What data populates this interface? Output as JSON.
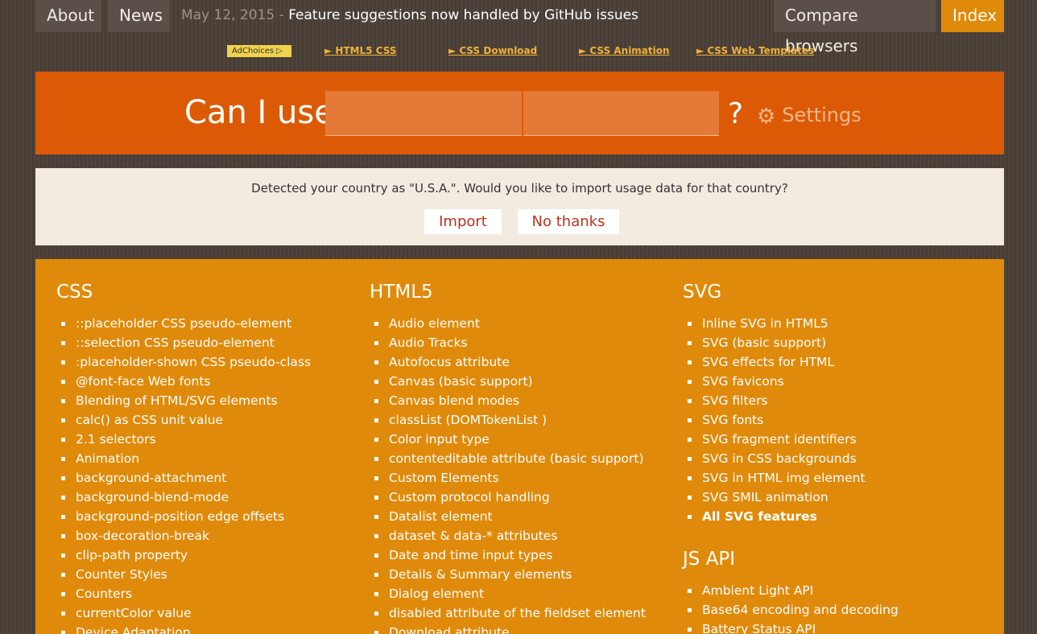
{
  "nav": {
    "about": "About",
    "news": "News",
    "news_date": "May 12, 2015 - ",
    "news_text": "Feature suggestions now handled by GitHub issues",
    "compare": "Compare browsers",
    "index": "Index"
  },
  "ads": {
    "choices": "AdChoices ▷",
    "links": [
      "► HTML5 CSS",
      "► CSS Download",
      "► CSS Animation",
      "► CSS Web Templates"
    ]
  },
  "search": {
    "label": "Can I use",
    "qmark": "?",
    "settings": "Settings",
    "gear_icon": "⚙",
    "input1_value": "",
    "input2_value": ""
  },
  "notice": {
    "text": "Detected your country as \"U.S.A.\". Would you like to import usage data for that country?",
    "import": "Import",
    "no_thanks": "No thanks"
  },
  "index": {
    "css": {
      "title": "CSS",
      "items": [
        "::placeholder CSS pseudo-element",
        "::selection CSS pseudo-element",
        ":placeholder-shown CSS pseudo-class",
        "@font-face Web fonts",
        "Blending of HTML/SVG elements",
        "calc() as CSS unit value",
        "2.1 selectors",
        "Animation",
        "background-attachment",
        "background-blend-mode",
        "background-position edge offsets",
        "box-decoration-break",
        "clip-path property",
        "Counter Styles",
        "Counters",
        "currentColor value",
        "Device Adaptation"
      ]
    },
    "html5": {
      "title": "HTML5",
      "items": [
        "Audio element",
        "Audio Tracks",
        "Autofocus attribute",
        "Canvas (basic support)",
        "Canvas blend modes",
        "classList (DOMTokenList )",
        "Color input type",
        "contenteditable attribute (basic support)",
        "Custom Elements",
        "Custom protocol handling",
        "Datalist element",
        "dataset & data-* attributes",
        "Date and time input types",
        "Details & Summary elements",
        "Dialog element",
        "disabled attribute of the fieldset element",
        "Download attribute"
      ]
    },
    "svg": {
      "title": "SVG",
      "items": [
        "Inline SVG in HTML5",
        "SVG (basic support)",
        "SVG effects for HTML",
        "SVG favicons",
        "SVG filters",
        "SVG fonts",
        "SVG fragment identifiers",
        "SVG in CSS backgrounds",
        "SVG in HTML img element",
        "SVG SMIL animation"
      ],
      "all": "All SVG features"
    },
    "jsapi": {
      "title": "JS API",
      "items": [
        "Ambient Light API",
        "Base64 encoding and decoding",
        "Battery Status API"
      ]
    }
  }
}
